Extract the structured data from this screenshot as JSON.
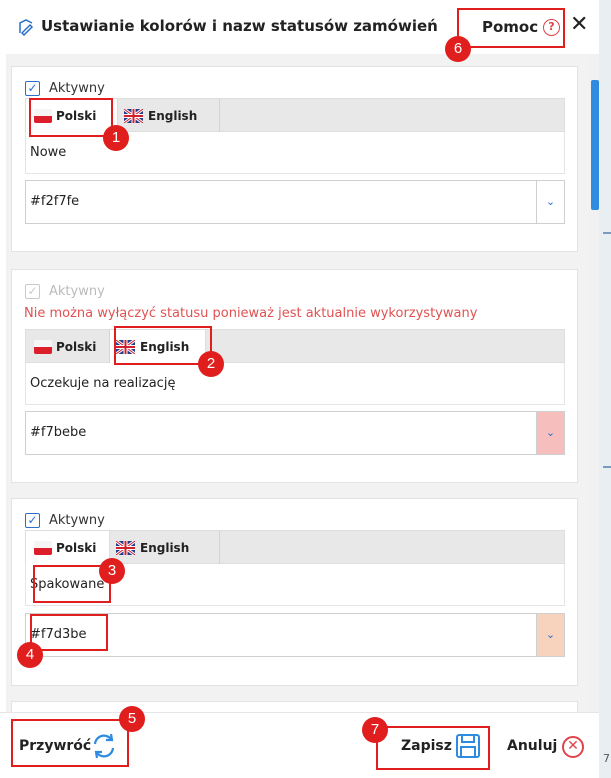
{
  "dialog": {
    "title": "Ustawianie kolorów i nazw statusów zamówień",
    "help_label": "Pomoc",
    "help_icon": "?",
    "close_label": "✕"
  },
  "statuses": [
    {
      "checkbox_label": "Aktywny",
      "checked": true,
      "disabled": false,
      "warning": "",
      "tabs": [
        "Polski",
        "English"
      ],
      "active_tab": "Polski",
      "name": "Nowe",
      "color_value": "#f2f7fe",
      "swatch_color": "#ffffff"
    },
    {
      "checkbox_label": "Aktywny",
      "checked": true,
      "disabled": true,
      "warning": "Nie można wyłączyć statusu ponieważ jest aktualnie wykorzystywany",
      "tabs": [
        "Polski",
        "English"
      ],
      "active_tab": "English",
      "name": "Oczekuje na realizację",
      "color_value": "#f7bebe",
      "swatch_color": "#f7bebe"
    },
    {
      "checkbox_label": "Aktywny",
      "checked": true,
      "disabled": false,
      "warning": "",
      "tabs": [
        "Polski",
        "English"
      ],
      "active_tab": "Polski",
      "name": "Spakowane",
      "color_value": "#f7d3be",
      "swatch_color": "#f7d3be"
    }
  ],
  "footer": {
    "restore_label": "Przywróć",
    "save_label": "Zapisz",
    "cancel_label": "Anuluj"
  },
  "annotations": [
    "1",
    "2",
    "3",
    "4",
    "5",
    "6",
    "7"
  ],
  "side_text": "7",
  "colors": {
    "accent_blue": "#2a6fc9",
    "annotation_red": "#e01e1e",
    "warning_red": "#e05252",
    "scroll_thumb": "#2f8be0"
  }
}
